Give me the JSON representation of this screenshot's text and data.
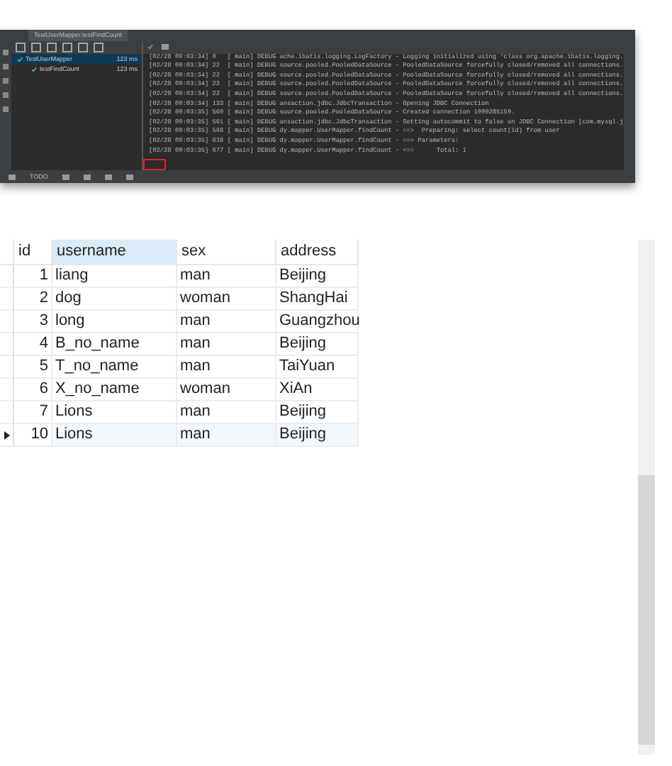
{
  "ide": {
    "tab": "TestUserMapper.testFindCount",
    "tree": [
      {
        "label": "TestUserMapper",
        "time": "123 ms",
        "selected": true,
        "children": [
          {
            "label": "testFindCount",
            "time": "123 ms",
            "selected": false
          }
        ]
      }
    ],
    "log": [
      "[02/28 09:03:34] 0   [ main] DEBUG ache.ibatis.logging.LogFactory - Logging initialized using 'class org.apache.ibatis.logging.",
      "[02/28 09:03:34] 22  [ main] DEBUG source.pooled.PooledDataSource - PooledDataSource forcefully closed/removed all connections.",
      "[02/28 09:03:34] 22  [ main] DEBUG source.pooled.PooledDataSource - PooledDataSource forcefully closed/removed all connections.",
      "[02/28 09:03:34] 22  [ main] DEBUG source.pooled.PooledDataSource - PooledDataSource forcefully closed/removed all connections.",
      "[02/28 09:03:34] 22  [ main] DEBUG source.pooled.PooledDataSource - PooledDataSource forcefully closed/removed all connections.",
      "[02/28 09:03:34] 133 [ main] DEBUG ansaction.jdbc.JdbcTransaction - Opening JDBC Connection",
      "[02/28 09:03:35] 560 [ main] DEBUG source.pooled.PooledDataSource - Created connection 1999285159.",
      "[02/28 09:03:35] 561 [ main] DEBUG ansaction.jdbc.JdbcTransaction - Setting autocommit to false on JDBC Connection [com.mysql.j",
      "[02/28 09:03:35] 568 [ main] DEBUG dy.mapper.UserMapper.findCount - ==>  Preparing: select count(id) from user",
      "[02/28 09:03:35] 638 [ main] DEBUG dy.mapper.UserMapper.findCount - ==> Parameters: ",
      "[02/28 09:03:35] 677 [ main] DEBUG dy.mapper.UserMapper.findCount - <==      Total: 1"
    ],
    "bottom": [
      "TODO"
    ]
  },
  "table": {
    "columns": [
      {
        "label": "id",
        "selected": false
      },
      {
        "label": "username",
        "selected": true
      },
      {
        "label": "sex",
        "selected": false
      },
      {
        "label": "address",
        "selected": false
      }
    ],
    "rows": [
      {
        "cells": [
          "1",
          "liang",
          "man",
          "Beijing"
        ],
        "current": false
      },
      {
        "cells": [
          "2",
          "dog",
          "woman",
          "ShangHai"
        ],
        "current": false
      },
      {
        "cells": [
          "3",
          "long",
          "man",
          "Guangzhou"
        ],
        "current": false
      },
      {
        "cells": [
          "4",
          "B_no_name",
          "man",
          "Beijing"
        ],
        "current": false
      },
      {
        "cells": [
          "5",
          "T_no_name",
          "man",
          "TaiYuan"
        ],
        "current": false
      },
      {
        "cells": [
          "6",
          "X_no_name",
          "woman",
          "XiAn"
        ],
        "current": false
      },
      {
        "cells": [
          "7",
          "Lions",
          "man",
          "Beijing"
        ],
        "current": false
      },
      {
        "cells": [
          "10",
          "Lions",
          "man",
          "Beijing"
        ],
        "current": true
      }
    ]
  }
}
